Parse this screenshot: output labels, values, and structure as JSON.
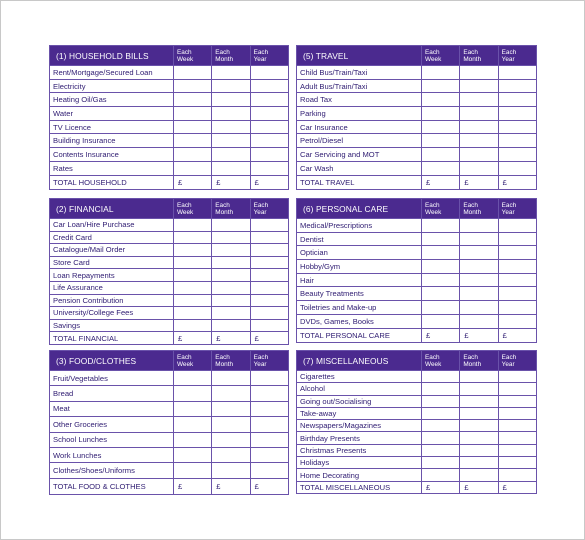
{
  "columns": [
    "Each Week",
    "Each Month",
    "Each Year"
  ],
  "column_lines": [
    [
      "Each",
      "Week"
    ],
    [
      "Each",
      "Month"
    ],
    [
      "Each",
      "Year"
    ]
  ],
  "currency_symbol": "£",
  "colors": {
    "header_bg": "#4b2a8f",
    "border": "#6a52aa",
    "text": "#2f1c72"
  },
  "sections": [
    {
      "title": "(1) HOUSEHOLD BILLS",
      "items": [
        "Rent/Mortgage/Secured Loan",
        "Electricity",
        "Heating Oil/Gas",
        "Water",
        "TV Licence",
        "Building Insurance",
        "Contents Insurance",
        "Rates"
      ],
      "total_label": "TOTAL HOUSEHOLD"
    },
    {
      "title": "(2) FINANCIAL",
      "items": [
        "Car Loan/Hire Purchase",
        "Credit Card",
        "Catalogue/Mail Order",
        "Store Card",
        "Loan Repayments",
        "Life Assurance",
        "Pension Contribution",
        "University/College Fees",
        "Savings"
      ],
      "total_label": "TOTAL FINANCIAL"
    },
    {
      "title": "(3) FOOD/CLOTHES",
      "items": [
        "Fruit/Vegetables",
        "Bread",
        "Meat",
        "Other Groceries",
        "School Lunches",
        "Work Lunches",
        "Clothes/Shoes/Uniforms"
      ],
      "total_label": "TOTAL FOOD & CLOTHES"
    },
    {
      "title": "(5) TRAVEL",
      "items": [
        "Child Bus/Train/Taxi",
        "Adult Bus/Train/Taxi",
        "Road Tax",
        "Parking",
        "Car Insurance",
        "Petrol/Diesel",
        "Car Servicing and MOT",
        "Car Wash"
      ],
      "total_label": "TOTAL TRAVEL"
    },
    {
      "title": "(6) PERSONAL CARE",
      "items": [
        "Medical/Prescriptions",
        "Dentist",
        "Optician",
        "Hobby/Gym",
        "Hair",
        "Beauty Treatments",
        "Toiletries and Make-up",
        "DVDs, Games, Books"
      ],
      "total_label": "TOTAL PERSONAL CARE"
    },
    {
      "title": "(7) MISCELLANEOUS",
      "items": [
        "Cigarettes",
        "Alcohol",
        "Going out/Socialising",
        "Take-away",
        "Newspapers/Magazines",
        "Birthday Presents",
        "Christmas Presents",
        "Holidays",
        "Home Decorating"
      ],
      "total_label": "TOTAL MISCELLANEOUS"
    }
  ]
}
